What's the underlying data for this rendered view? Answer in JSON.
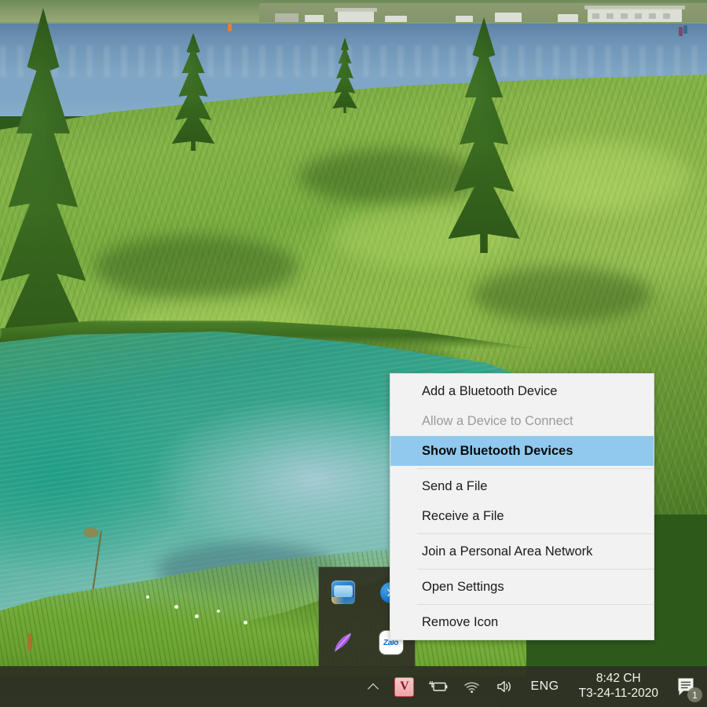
{
  "desktop": {
    "wallpaper_description": "alpine lake with green grassy hillside and conifer trees",
    "colors": {
      "taskbar": "#2f3224",
      "menu_background": "#f2f2f2",
      "menu_highlight": "#91c9ee",
      "menu_text": "#1a1a1a",
      "menu_disabled_text": "#9b9b9b",
      "separator": "#dcdcdc"
    }
  },
  "context_menu": {
    "name": "bluetooth-tray-context-menu",
    "items": [
      {
        "label": "Add a Bluetooth Device",
        "state": "normal",
        "separator_after": false
      },
      {
        "label": "Allow a Device to Connect",
        "state": "disabled",
        "separator_after": false
      },
      {
        "label": "Show Bluetooth Devices",
        "state": "selected",
        "separator_after": true
      },
      {
        "label": "Send a File",
        "state": "normal",
        "separator_after": false
      },
      {
        "label": "Receive a File",
        "state": "normal",
        "separator_after": true
      },
      {
        "label": "Join a Personal Area Network",
        "state": "normal",
        "separator_after": true
      },
      {
        "label": "Open Settings",
        "state": "normal",
        "separator_after": true
      },
      {
        "label": "Remove Icon",
        "state": "normal",
        "separator_after": false
      }
    ]
  },
  "tray_flyout": {
    "name": "hidden-icons-flyout",
    "icons": [
      {
        "name": "intel-graphics-icon",
        "label": "Intel Graphics"
      },
      {
        "name": "bluetooth-icon",
        "label": "Bluetooth"
      },
      {
        "name": "feather-icon",
        "label": "Feather"
      },
      {
        "name": "zalo-icon",
        "label": "Zalo",
        "badge": true
      }
    ]
  },
  "taskbar": {
    "show_hidden_icons": {
      "name": "show-hidden-icons-chevron",
      "label": "^"
    },
    "tray_icons": [
      {
        "name": "vietkey-icon",
        "label": "V"
      },
      {
        "name": "battery-charging-icon",
        "label": "Battery"
      },
      {
        "name": "wifi-icon",
        "label": "Network"
      },
      {
        "name": "volume-icon",
        "label": "Volume"
      }
    ],
    "language": "ENG",
    "clock": {
      "time": "8:42 CH",
      "date": "T3-24-11-2020"
    },
    "action_center": {
      "name": "action-center-icon",
      "badge_count": "1"
    }
  }
}
